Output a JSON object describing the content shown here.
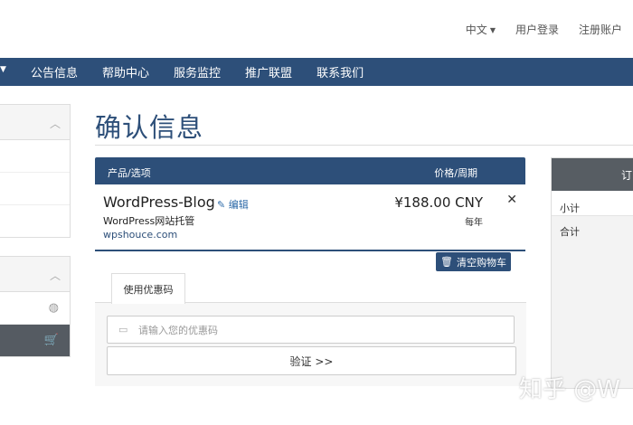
{
  "top_links": {
    "language": "中文",
    "login": "用户登录",
    "register": "注册账户"
  },
  "nav": {
    "items": [
      "公告信息",
      "帮助中心",
      "服务监控",
      "推广联盟",
      "联系我们"
    ]
  },
  "page": {
    "title": "确认信息"
  },
  "cart_table": {
    "col_product": "产品/选项",
    "col_price": "价格/周期"
  },
  "product": {
    "name": "WordPress-Blog",
    "edit_label": "编辑",
    "description": "WordPress网站托管",
    "domain": "wpshouce.com",
    "price": "¥188.00 CNY",
    "cycle": "每年"
  },
  "clear_cart_label": "清空购物车",
  "promo": {
    "tab_label": "使用优惠码",
    "placeholder": "请输入您的优惠码",
    "verify_label": "验证 >>"
  },
  "summary": {
    "subtotal_label": "小计",
    "total_label": "合计",
    "header_partial": "订"
  },
  "watermark": "知乎 @W",
  "colors": {
    "brand": "#2d4f79",
    "dark_panel": "#575d63"
  }
}
